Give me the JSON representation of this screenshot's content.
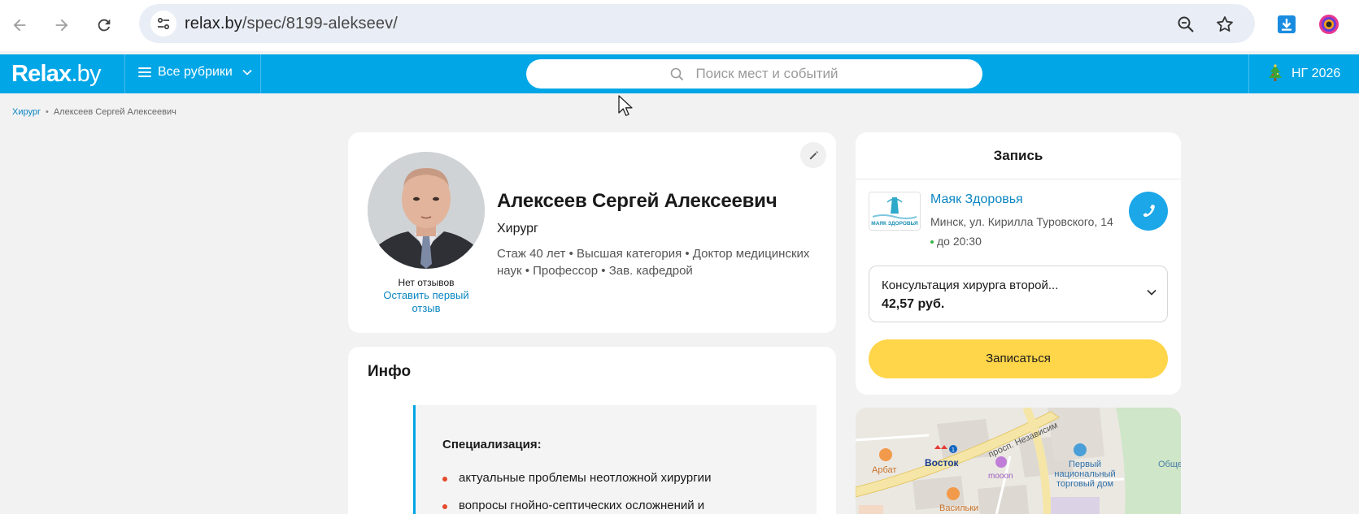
{
  "browser": {
    "url_host": "relax.by",
    "url_path": "/spec/8199-alekseev/"
  },
  "header": {
    "logo": "Relax",
    "logo_suffix": ".by",
    "rubrics_label": "Все рубрики",
    "search_placeholder": "Поиск мест и событий",
    "promo_label": "НГ 2026"
  },
  "breadcrumbs": {
    "items": [
      "Хирург",
      "Алексеев Сергей Алексеевич"
    ]
  },
  "profile": {
    "name": "Алексеев Сергей Алексеевич",
    "specialty": "Хирург",
    "meta": "Стаж 40 лет  •  Высшая категория • Доктор медицинских наук • Профессор • Зав. кафедрой",
    "reviews_status": "Нет отзывов",
    "leave_review_label": "Оставить первый отзыв"
  },
  "info": {
    "title": "Инфо",
    "spec_title": "Специализация:",
    "spec_items": [
      "актуальные проблемы неотложной хирургии",
      "вопросы гнойно-септических осложнений и"
    ]
  },
  "booking": {
    "title": "Запись",
    "clinic_name": "Маяк Здоровья",
    "clinic_logo_text": "МАЯК ЗДОРОВЬЯ",
    "clinic_address": "Минск, ул. Кирилла Туровского, 14",
    "clinic_hours": "до 20:30",
    "service_name": "Консультация хирурга второй...",
    "service_price": "42,57 руб.",
    "book_button": "Записаться"
  },
  "map": {
    "labels": {
      "street": "просп. Независим",
      "metro": "Восток",
      "arbat": "Арбат",
      "mooon": "mooon",
      "vasilki": "Васильки",
      "tc": "Первый национальный торговый дом",
      "other": "Обще"
    }
  },
  "colors": {
    "brand": "#00a6e6",
    "link": "#0a86c0",
    "book_button": "#ffd54a"
  }
}
